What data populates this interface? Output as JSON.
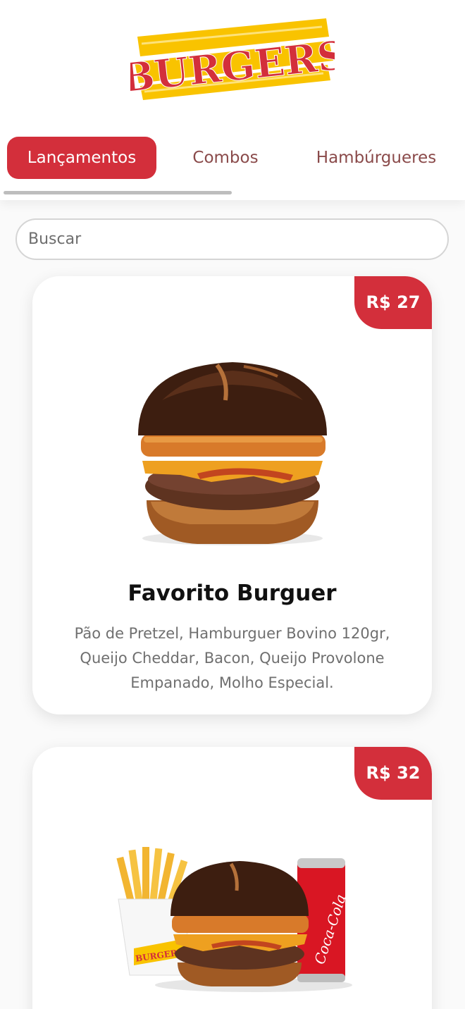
{
  "brand": {
    "logo_text": "BURGERS",
    "accent": "#d32f3b",
    "logo_yellow": "#f9c300"
  },
  "tabs": [
    {
      "label": "Lançamentos",
      "active": true
    },
    {
      "label": "Combos",
      "active": false
    },
    {
      "label": "Hambúrgueres",
      "active": false
    }
  ],
  "search": {
    "placeholder": "Buscar",
    "value": ""
  },
  "products": [
    {
      "price": "R$ 27",
      "name": "Favorito Burguer",
      "description": "Pão de Pretzel, Hamburguer Bovino 120gr, Queijo Cheddar, Bacon, Queijo Provolone Empanado, Molho Especial.",
      "image": "burger-photo"
    },
    {
      "price": "R$ 32",
      "name": "",
      "description": "",
      "image": "combo-photo",
      "cup_text": "BURGERS",
      "can_text": "Coca-Cola"
    }
  ]
}
